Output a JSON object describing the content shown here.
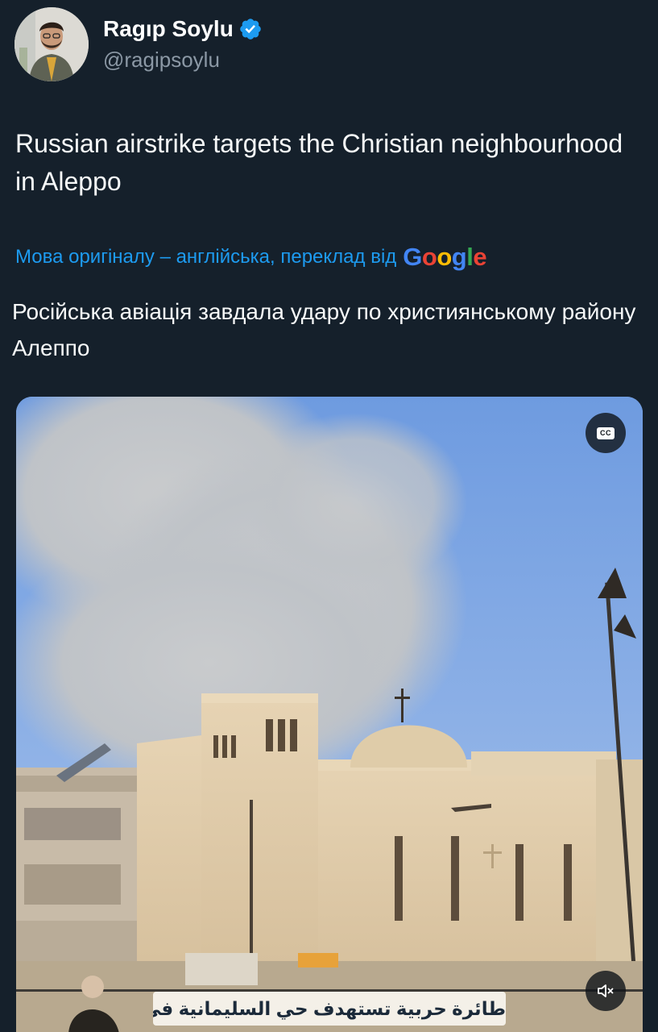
{
  "author": {
    "display_name": "Ragıp Soylu",
    "handle": "@ragipsoylu",
    "verified": true,
    "avatar_icon": "profile-photo"
  },
  "tweet": {
    "text": "Russian airstrike targets the Christian neighbourhood in Aleppo"
  },
  "translation": {
    "notice": "Мова оригіналу – англійська, переклад від",
    "provider_logo": "Google",
    "translated_text": "Російська авіація завдала удару по християнському району Алеппо"
  },
  "media": {
    "type": "video",
    "caption_overlay": "طائرة حربية تستهدف حي السليمانية في حلب",
    "captions_button_label": "CC",
    "captions_icon": "closed-captions-icon",
    "mute_icon": "speaker-muted-icon"
  },
  "colors": {
    "background": "#15202b",
    "link": "#1d9bf0",
    "secondary_text": "#8b98a5",
    "verified_badge": "#1d9bf0"
  }
}
